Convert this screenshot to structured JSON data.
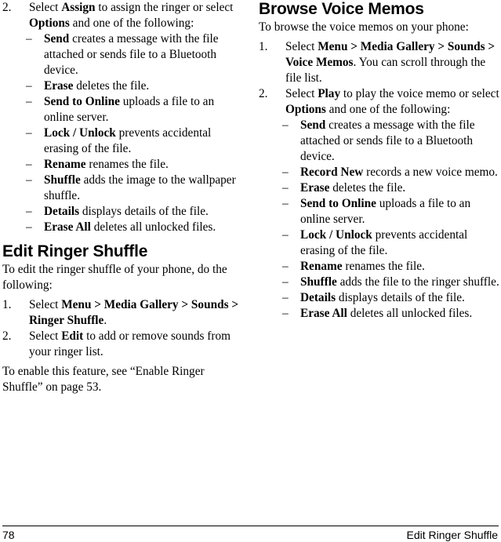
{
  "page": {
    "number": "78",
    "footer_title": "Edit Ringer Shuffle"
  },
  "left_column": {
    "continued_item": {
      "marker": "2.",
      "lead_plain_1": "Select ",
      "lead_bold_1": "Assign",
      "lead_plain_2": " to assign the ringer or select ",
      "lead_bold_2": "Options",
      "lead_plain_3": " and one of the following:"
    },
    "options": [
      {
        "marker": "–",
        "term": "Send",
        "desc": " creates a message with the file attached or sends file to a Bluetooth device."
      },
      {
        "marker": "–",
        "term": "Erase",
        "desc": " deletes the file."
      },
      {
        "marker": "–",
        "term": "Send to Online",
        "desc": " uploads a file to an online server."
      },
      {
        "marker": "–",
        "term": "Lock / Unlock",
        "desc": " prevents accidental erasing of the file."
      },
      {
        "marker": "–",
        "term": "Rename",
        "desc": " renames the file."
      },
      {
        "marker": "–",
        "term": "Shuffle",
        "desc": " adds the image to the wallpaper shuffle."
      },
      {
        "marker": "–",
        "term": "Details",
        "desc": " displays details of the file."
      },
      {
        "marker": "–",
        "term": "Erase All",
        "desc": " deletes all unlocked files."
      }
    ],
    "section": {
      "heading": "Edit Ringer Shuffle",
      "intro": "To edit the ringer shuffle of your phone, do the following:",
      "steps": [
        {
          "marker": "1.",
          "plain_1": "Select ",
          "bold_1": "Menu > Media Gallery > Sounds > Ringer Shuffle",
          "plain_2": "."
        },
        {
          "marker": "2.",
          "plain_1": "Select ",
          "bold_1": "Edit",
          "plain_2": " to add or remove sounds from your ringer list."
        }
      ],
      "closing": "To enable this feature, see “Enable Ringer Shuffle” on page 53."
    }
  },
  "right_column": {
    "section": {
      "heading": "Browse Voice Memos",
      "intro": "To browse the voice memos on your phone:",
      "steps": [
        {
          "marker": "1.",
          "plain_1": "Select ",
          "bold_1": "Menu > Media Gallery > Sounds > Voice Memos",
          "plain_2": ". You can scroll through the file list."
        },
        {
          "marker": "2.",
          "plain_1": "Select ",
          "bold_1": "Play",
          "plain_2": " to play the voice memo or select ",
          "bold_2": "Options",
          "plain_3": " and one of the following:"
        }
      ],
      "options": [
        {
          "marker": "–",
          "term": "Send",
          "desc": " creates a message with the file attached or sends file to a Bluetooth device."
        },
        {
          "marker": "–",
          "term": "Record New",
          "desc": " records a new voice memo."
        },
        {
          "marker": "–",
          "term": "Erase",
          "desc": " deletes the file."
        },
        {
          "marker": "–",
          "term": "Send to Online",
          "desc": " uploads a file to an online server."
        },
        {
          "marker": "–",
          "term": "Lock / Unlock",
          "desc": " prevents accidental erasing of the file."
        },
        {
          "marker": "–",
          "term": "Rename",
          "desc": " renames the file."
        },
        {
          "marker": "–",
          "term": "Shuffle",
          "desc": " adds the file to the ringer shuffle."
        },
        {
          "marker": "–",
          "term": "Details",
          "desc": " displays details of the file."
        },
        {
          "marker": "–",
          "term": "Erase All",
          "desc": " deletes all unlocked files."
        }
      ]
    }
  }
}
